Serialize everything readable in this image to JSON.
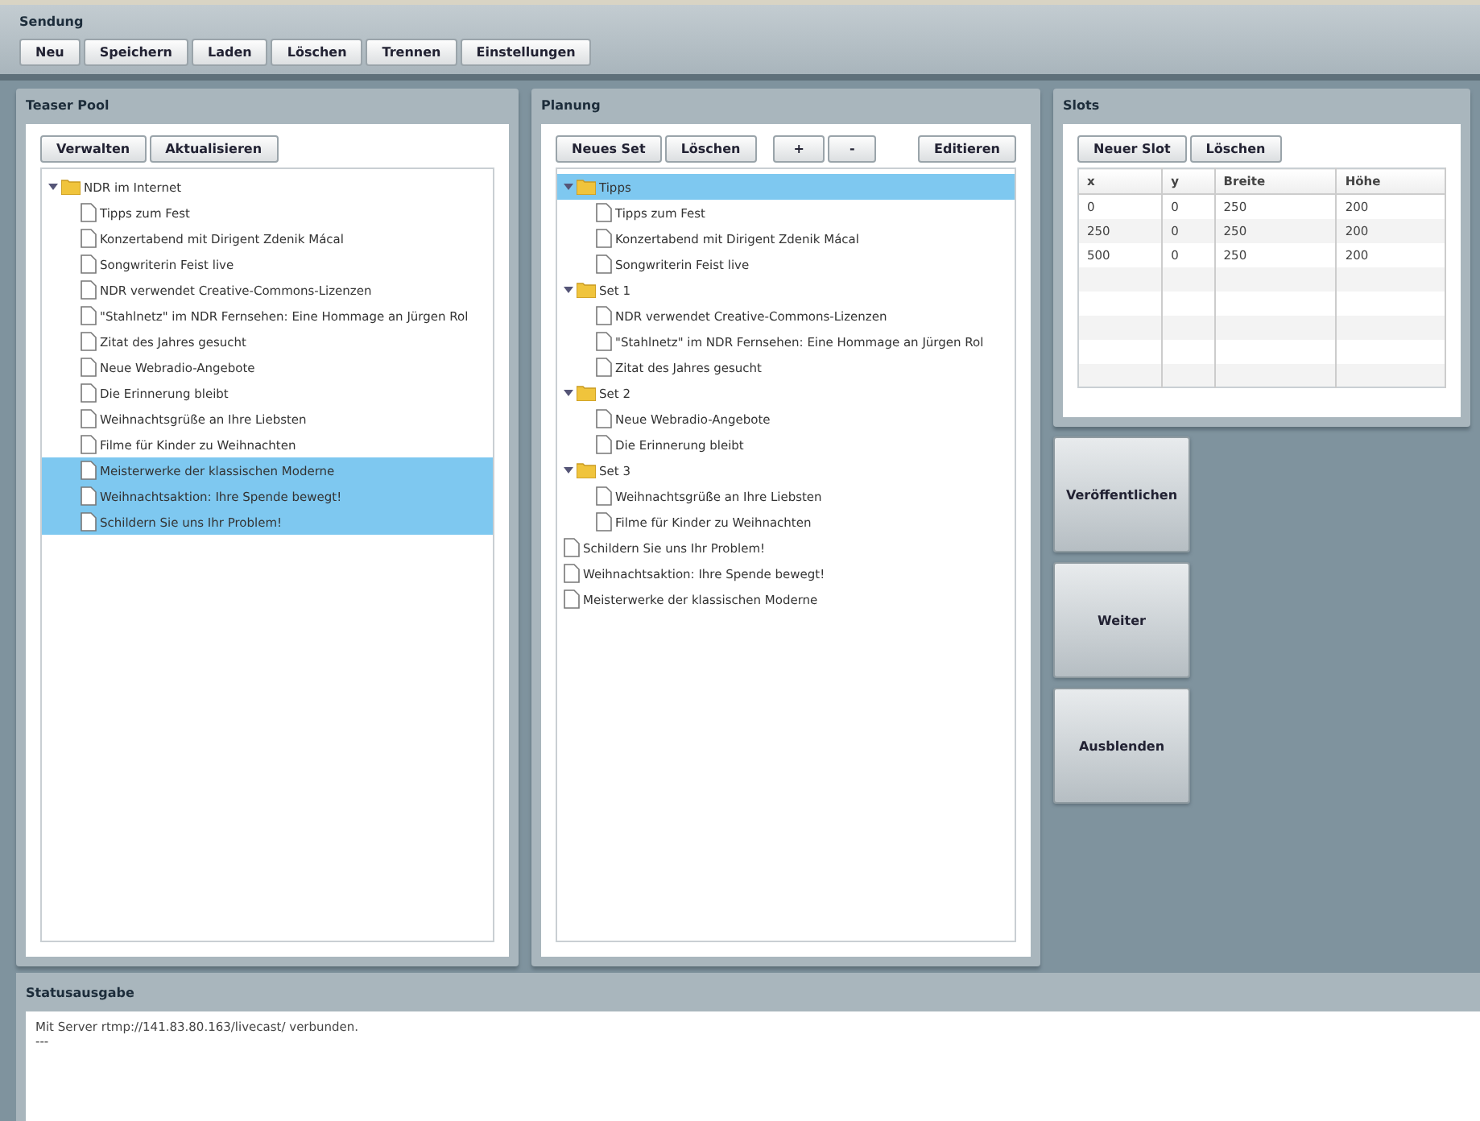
{
  "sendung": {
    "title": "Sendung",
    "buttons": [
      "Neu",
      "Speichern",
      "Laden",
      "Löschen",
      "Trennen",
      "Einstellungen"
    ]
  },
  "teaser_pool": {
    "title": "Teaser Pool",
    "buttons": [
      "Verwalten",
      "Aktualisieren"
    ],
    "tree": [
      {
        "kind": "folder",
        "label": "NDR im Internet",
        "expanded": true,
        "selected": false,
        "children": [
          {
            "kind": "doc",
            "label": "Tipps zum Fest",
            "selected": false
          },
          {
            "kind": "doc",
            "label": "Konzertabend mit Dirigent Zdenik Mácal",
            "selected": false
          },
          {
            "kind": "doc",
            "label": "Songwriterin Feist live",
            "selected": false
          },
          {
            "kind": "doc",
            "label": "NDR verwendet Creative-Commons-Lizenzen",
            "selected": false
          },
          {
            "kind": "doc",
            "label": "\"Stahlnetz\" im NDR Fernsehen: Eine Hommage an Jürgen Rol",
            "selected": false
          },
          {
            "kind": "doc",
            "label": "Zitat des Jahres gesucht",
            "selected": false
          },
          {
            "kind": "doc",
            "label": "Neue Webradio-Angebote",
            "selected": false
          },
          {
            "kind": "doc",
            "label": "Die Erinnerung bleibt",
            "selected": false
          },
          {
            "kind": "doc",
            "label": "Weihnachtsgrüße an Ihre Liebsten",
            "selected": false
          },
          {
            "kind": "doc",
            "label": "Filme für Kinder zu Weihnachten",
            "selected": false
          },
          {
            "kind": "doc",
            "label": "Meisterwerke der klassischen Moderne",
            "selected": true
          },
          {
            "kind": "doc",
            "label": "Weihnachtsaktion: Ihre Spende bewegt!",
            "selected": true
          },
          {
            "kind": "doc",
            "label": "Schildern Sie uns Ihr Problem!",
            "selected": true
          }
        ]
      }
    ]
  },
  "planning": {
    "title": "Planung",
    "buttons": [
      "Neues Set",
      "Löschen"
    ],
    "step_buttons": [
      "+",
      "-"
    ],
    "edit_button": "Editieren",
    "tree": [
      {
        "kind": "folder",
        "label": "Tipps",
        "expanded": true,
        "selected": true,
        "children": [
          {
            "kind": "doc",
            "label": "Tipps zum Fest",
            "selected": false
          },
          {
            "kind": "doc",
            "label": "Konzertabend mit Dirigent Zdenik Mácal",
            "selected": false
          },
          {
            "kind": "doc",
            "label": "Songwriterin Feist live",
            "selected": false
          }
        ]
      },
      {
        "kind": "folder",
        "label": "Set 1",
        "expanded": true,
        "selected": false,
        "children": [
          {
            "kind": "doc",
            "label": "NDR verwendet Creative-Commons-Lizenzen",
            "selected": false
          },
          {
            "kind": "doc",
            "label": "\"Stahlnetz\" im NDR Fernsehen: Eine Hommage an Jürgen Rol",
            "selected": false
          },
          {
            "kind": "doc",
            "label": "Zitat des Jahres gesucht",
            "selected": false
          }
        ]
      },
      {
        "kind": "folder",
        "label": "Set 2",
        "expanded": true,
        "selected": false,
        "children": [
          {
            "kind": "doc",
            "label": "Neue Webradio-Angebote",
            "selected": false
          },
          {
            "kind": "doc",
            "label": "Die Erinnerung bleibt",
            "selected": false
          }
        ]
      },
      {
        "kind": "folder",
        "label": "Set 3",
        "expanded": true,
        "selected": false,
        "children": [
          {
            "kind": "doc",
            "label": "Weihnachtsgrüße an Ihre Liebsten",
            "selected": false
          },
          {
            "kind": "doc",
            "label": "Filme für Kinder zu Weihnachten",
            "selected": false
          }
        ]
      },
      {
        "kind": "doc",
        "label": "Schildern Sie uns Ihr Problem!",
        "selected": false
      },
      {
        "kind": "doc",
        "label": "Weihnachtsaktion: Ihre Spende bewegt!",
        "selected": false
      },
      {
        "kind": "doc",
        "label": "Meisterwerke der klassischen Moderne",
        "selected": false
      }
    ]
  },
  "slots": {
    "title": "Slots",
    "buttons": [
      "Neuer Slot",
      "Löschen"
    ],
    "table": {
      "columns": [
        "x",
        "y",
        "Breite",
        "Höhe"
      ],
      "rows": [
        [
          "0",
          "0",
          "250",
          "200"
        ],
        [
          "250",
          "0",
          "250",
          "200"
        ],
        [
          "500",
          "0",
          "250",
          "200"
        ]
      ]
    }
  },
  "actions": [
    "Veröffentlichen",
    "Weiter",
    "Ausblenden"
  ],
  "status": {
    "title": "Statusausgabe",
    "lines": [
      "Mit Server rtmp://141.83.80.163/livecast/ verbunden.",
      "---"
    ]
  }
}
